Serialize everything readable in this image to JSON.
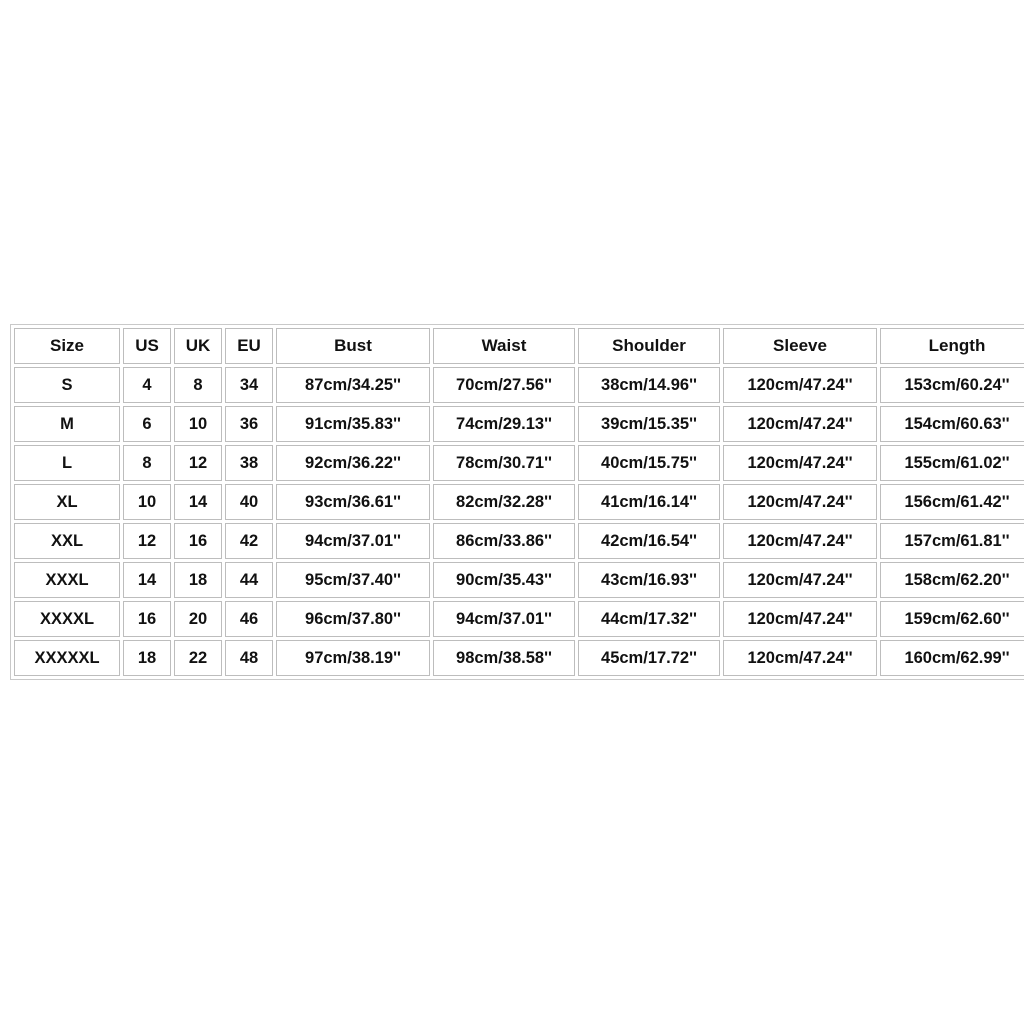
{
  "table": {
    "columns": [
      "Size",
      "US",
      "UK",
      "EU",
      "Bust",
      "Waist",
      "Shoulder",
      "Sleeve",
      "Length"
    ],
    "rows": [
      [
        "S",
        "4",
        "8",
        "34",
        "87cm/34.25''",
        "70cm/27.56''",
        "38cm/14.96''",
        "120cm/47.24''",
        "153cm/60.24''"
      ],
      [
        "M",
        "6",
        "10",
        "36",
        "91cm/35.83''",
        "74cm/29.13''",
        "39cm/15.35''",
        "120cm/47.24''",
        "154cm/60.63''"
      ],
      [
        "L",
        "8",
        "12",
        "38",
        "92cm/36.22''",
        "78cm/30.71''",
        "40cm/15.75''",
        "120cm/47.24''",
        "155cm/61.02''"
      ],
      [
        "XL",
        "10",
        "14",
        "40",
        "93cm/36.61''",
        "82cm/32.28''",
        "41cm/16.14''",
        "120cm/47.24''",
        "156cm/61.42''"
      ],
      [
        "XXL",
        "12",
        "16",
        "42",
        "94cm/37.01''",
        "86cm/33.86''",
        "42cm/16.54''",
        "120cm/47.24''",
        "157cm/61.81''"
      ],
      [
        "XXXL",
        "14",
        "18",
        "44",
        "95cm/37.40''",
        "90cm/35.43''",
        "43cm/16.93''",
        "120cm/47.24''",
        "158cm/62.20''"
      ],
      [
        "XXXXL",
        "16",
        "20",
        "46",
        "96cm/37.80''",
        "94cm/37.01''",
        "44cm/17.32''",
        "120cm/47.24''",
        "159cm/62.60''"
      ],
      [
        "XXXXXL",
        "18",
        "22",
        "48",
        "97cm/38.19''",
        "98cm/38.58''",
        "45cm/17.72''",
        "120cm/47.24''",
        "160cm/62.99''"
      ]
    ]
  },
  "colors": {
    "background": "#ffffff",
    "text": "#111111",
    "cell_border": "#bdbdbd",
    "table_border": "#c9c9c9"
  }
}
